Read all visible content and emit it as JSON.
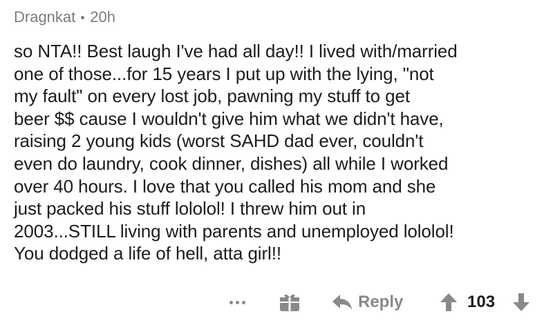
{
  "comment": {
    "author": "Dragnkat",
    "age": "20h",
    "text": "so NTA!! Best laugh I've had all day!! I lived with/married\none of those...for 15 years I put up with the lying, \"not\nmy fault\" on every lost job, pawning my stuff to get\nbeer $$ cause I wouldn't give him what we didn't have,\nraising 2 young kids (worst SAHD dad ever, couldn't\neven do laundry, cook dinner, dishes) all while I worked\nover 40 hours. I love that you called his mom and she\njust packed his stuff lololol! I threw him out in\n2003...STILL living with parents and unemployed lololol!\nYou dodged a life of hell, atta girl!!"
  },
  "actions": {
    "more_icon": "more-dots-icon",
    "award_icon": "gift-icon",
    "reply_icon": "reply-arrow-icon",
    "reply_label": "Reply",
    "upvote_icon": "upvote-arrow-icon",
    "score": "103",
    "downvote_icon": "downvote-arrow-icon"
  },
  "colors": {
    "meta": "#7c7c7c",
    "text": "#1c1c1c",
    "icon": "#878a8c"
  }
}
